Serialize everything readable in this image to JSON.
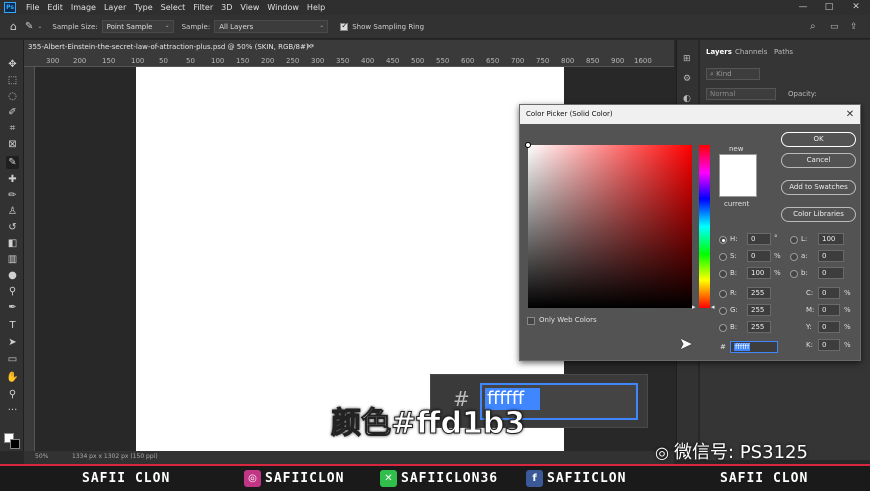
{
  "menu": {
    "logo": "Ps",
    "items": [
      "File",
      "Edit",
      "Image",
      "Layer",
      "Type",
      "Select",
      "Filter",
      "3D",
      "View",
      "Window",
      "Help"
    ],
    "window_controls": [
      "—",
      "□",
      "✕"
    ]
  },
  "options_bar": {
    "sample_size_label": "Sample Size:",
    "sample_size_value": "Point Sample",
    "sample_label": "Sample:",
    "sample_value": "All Layers",
    "show_ring_label": "Show Sampling Ring"
  },
  "document": {
    "tab_title": "355-Albert-Einstein-the-secret-law-of-attraction-plus.psd @ 50% (SKIN, RGB/8#) *",
    "ruler_ticks": [
      "300",
      "200",
      "150",
      "100",
      "50",
      "0",
      "50",
      "100",
      "150",
      "200",
      "250",
      "300",
      "350",
      "400",
      "450",
      "500",
      "550",
      "600",
      "650",
      "700",
      "750",
      "800",
      "850",
      "900",
      "950",
      "1000",
      "1050",
      "1100",
      "1150",
      "1200",
      "1250",
      "1300",
      "1350",
      "1400",
      "1450",
      "1500",
      "1550",
      "1600"
    ]
  },
  "status_bar": {
    "zoom": "50%",
    "doc_info": "1334 px x 1302 px (150 ppi)"
  },
  "layers_panel": {
    "tabs": [
      "Layers",
      "Channels",
      "Paths"
    ],
    "kind_label": "Kind",
    "blend_mode": "Normal",
    "opacity_label": "Opacity:"
  },
  "color_picker": {
    "title": "Color Picker (Solid Color)",
    "new_label": "new",
    "current_label": "current",
    "buttons": {
      "ok": "OK",
      "cancel": "Cancel",
      "add_swatches": "Add to Swatches",
      "libraries": "Color Libraries"
    },
    "only_web_colors": "Only Web Colors",
    "hsb": {
      "h_label": "H:",
      "h": "0",
      "h_unit": "°",
      "s_label": "S:",
      "s": "0",
      "s_unit": "%",
      "b_label": "B:",
      "b": "100",
      "b_unit": "%"
    },
    "rgb": {
      "r_label": "R:",
      "r": "255",
      "g_label": "G:",
      "g": "255",
      "b_label": "B:",
      "b": "255"
    },
    "lab": {
      "l_label": "L:",
      "l": "100",
      "a_label": "a:",
      "a": "0",
      "b_label": "b:",
      "b": "0"
    },
    "cmyk": {
      "c_label": "C:",
      "c": "0",
      "m_label": "M:",
      "m": "0",
      "y_label": "Y:",
      "y": "0",
      "k_label": "K:",
      "k": "0",
      "unit": "%"
    },
    "hex_label": "#",
    "hex": "ffffff",
    "selected_color": "#ffffff"
  },
  "zoom_overlay": {
    "hash": "#",
    "hex": "ffffff"
  },
  "subtitle": "颜色#ffd1b3",
  "watermark": "微信号: PS3125",
  "branding": {
    "left": "SAFII CLON",
    "instagram": "SAFIICLON",
    "other": "SAFIICLON36",
    "facebook": "SAFIICLON",
    "right": "SAFII CLON",
    "accent": "#d7263d"
  }
}
